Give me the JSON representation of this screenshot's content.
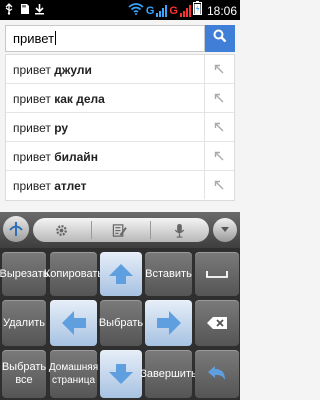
{
  "status_bar": {
    "time": "18:06",
    "network_1": "G",
    "network_2": "G",
    "icons": [
      "usb-icon",
      "sd-card-icon",
      "download-icon",
      "wifi-icon",
      "battery-charging-icon"
    ]
  },
  "search": {
    "query": "привет",
    "button_icon": "search-icon",
    "suggestions": [
      {
        "prefix": "привет",
        "completion": " джули"
      },
      {
        "prefix": "привет",
        "completion": " как дела"
      },
      {
        "prefix": "привет",
        "completion": " ру"
      },
      {
        "prefix": "привет",
        "completion": " билайн"
      },
      {
        "prefix": "привет",
        "completion": " атлет"
      }
    ]
  },
  "keyboard": {
    "toolbar_icons": [
      "keyboard-logo-icon",
      "settings-icon",
      "edit-icon",
      "microphone-icon",
      "hide-keyboard-icon"
    ],
    "keys": {
      "cut": "Вырезать",
      "copy": "Копировать",
      "paste": "Вставить",
      "delete": "Удалить",
      "select": "Выбрать",
      "select_all": "Выбрать все",
      "home_page": "Домашняя страница",
      "finish": "Завершить"
    },
    "colors": {
      "arrow_key": "#bcd2ec",
      "search_button": "#3f7fd8"
    }
  }
}
